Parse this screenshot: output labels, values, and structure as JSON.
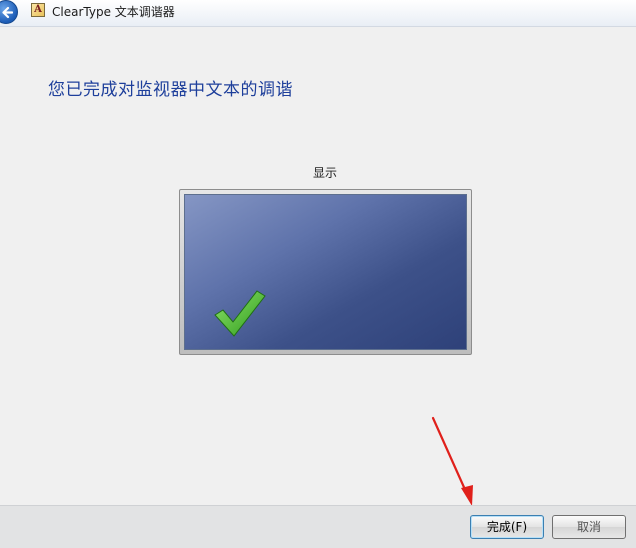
{
  "window": {
    "title": "ClearType 文本调谐器",
    "icon_glyph": "A"
  },
  "content": {
    "heading": "您已完成对监视器中文本的调谐",
    "display_label": "显示"
  },
  "buttons": {
    "finish_label": "完成(F)",
    "cancel_label": "取消"
  },
  "colors": {
    "heading": "#1e3f9b",
    "screen_dark": "#2e4179",
    "checkmark": "#47b82c",
    "annotation_arrow": "#e0201b"
  },
  "icons": {
    "back": "back-arrow-icon",
    "app": "cleartype-app-icon",
    "status": "checkmark-icon",
    "annotation": "red-arrow-annotation"
  }
}
